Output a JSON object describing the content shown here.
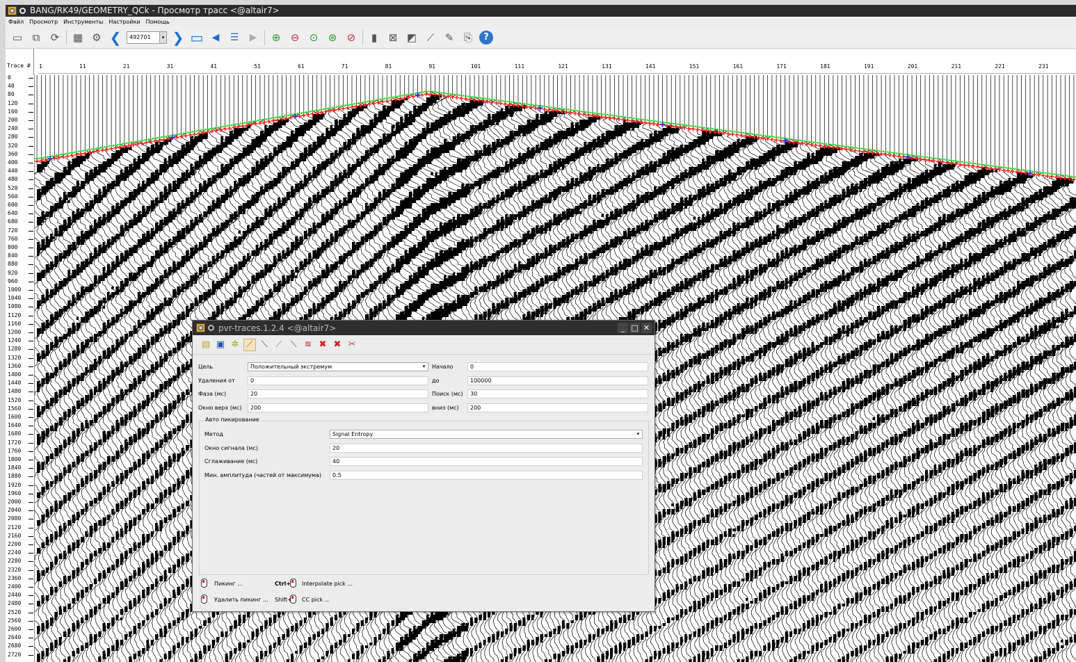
{
  "main_window": {
    "title": "BANG/RK49/GEOMETRY_QCk - Просмотр трасс <@altair7>",
    "menu": [
      "Файл",
      "Просмотр",
      "Инструменты",
      "Настройки",
      "Помощь"
    ],
    "toolbar": {
      "trace_input": "492701",
      "icons": [
        "open-icon",
        "copy-icon",
        "refresh-icon",
        "gather-icon",
        "settings-icon",
        "prev-icon",
        "next-icon",
        "window-icon",
        "back-icon",
        "list-icon",
        "forward-icon",
        "zoom-in-icon",
        "zoom-out-icon",
        "zoom-fit-icon",
        "zoom-x-icon",
        "zoom-y-icon",
        "amplitude-icon",
        "spectrum-icon",
        "display-icon",
        "pick-icon",
        "edit-pick-icon",
        "export-icon",
        "help-icon"
      ]
    }
  },
  "trace_header": {
    "label": "Trace #",
    "ticks": [
      "1",
      "11",
      "21",
      "31",
      "41",
      "51",
      "61",
      "71",
      "81",
      "91",
      "101",
      "111",
      "121",
      "131",
      "141",
      "151",
      "161",
      "171",
      "181",
      "191",
      "201",
      "211",
      "221",
      "231"
    ]
  },
  "time_axis": {
    "ticks": [
      "0",
      "40",
      "80",
      "120",
      "160",
      "200",
      "240",
      "280",
      "320",
      "360",
      "400",
      "440",
      "480",
      "520",
      "560",
      "600",
      "640",
      "680",
      "720",
      "760",
      "800",
      "840",
      "880",
      "920",
      "960",
      "1000",
      "1040",
      "1080",
      "1120",
      "1160",
      "1200",
      "1240",
      "1280",
      "1320",
      "1360",
      "1400",
      "1440",
      "1480",
      "1520",
      "1560",
      "1600",
      "1640",
      "1680",
      "1720",
      "1760",
      "1800",
      "1840",
      "1880",
      "1920",
      "1960",
      "2000",
      "2040",
      "2080",
      "2120",
      "2160",
      "2200",
      "2240",
      "2280",
      "2320",
      "2360",
      "2400",
      "2440",
      "2480",
      "2520",
      "2560",
      "2600",
      "2640",
      "2680",
      "2720"
    ]
  },
  "colors": {
    "pick_red": "#ff2020",
    "pick_green": "#30e030",
    "pick_blue": "#2030ff",
    "wiggle": "#000000"
  },
  "dialog": {
    "title": "pvr-traces.1.2.4 <@altair7>",
    "toolbar_icons": [
      "save-icon",
      "save-as-icon",
      "auto-pick-icon",
      "pick-mode-icon",
      "pick-line-icon",
      "pick-single-icon",
      "pick-slope-icon",
      "pick-range-icon",
      "delete-pick-icon",
      "delete-all-icon",
      "tools-icon"
    ],
    "fields": {
      "target_label": "Цель",
      "target_value": "Положительный экстремум",
      "start_label": "Начало",
      "start_value": "0",
      "offset_from_label": "Удаления от",
      "offset_from_value": "0",
      "offset_to_label": "до",
      "offset_to_value": "100000",
      "phase_label": "Фаза (мс)",
      "phase_value": "20",
      "search_label": "Поиск (мс)",
      "search_value": "30",
      "win_top_label": "Окно верх (мс)",
      "win_top_value": "200",
      "win_bottom_label": "вниз (мс)",
      "win_bottom_value": "200"
    },
    "auto": {
      "group_title": "Авто пикирование",
      "method_label": "Метод",
      "method_value": "Signal Entropy",
      "signal_window_label": "Окно сигнала (мс)",
      "signal_window_value": "20",
      "smoothing_label": "Сглаживание (мс)",
      "smoothing_value": "40",
      "min_amp_label": "Мин. амплитуда (частей от максимума)",
      "min_amp_value": "0.5"
    },
    "hints": {
      "pick": "Пикинг ...",
      "delete_pick": "Удалить пикинг ...",
      "ctrl_key": "Ctrl+",
      "shift_key": "Shift+",
      "interpolate": "Interpolate pick ...",
      "cc_pick": "CC pick ..."
    }
  }
}
